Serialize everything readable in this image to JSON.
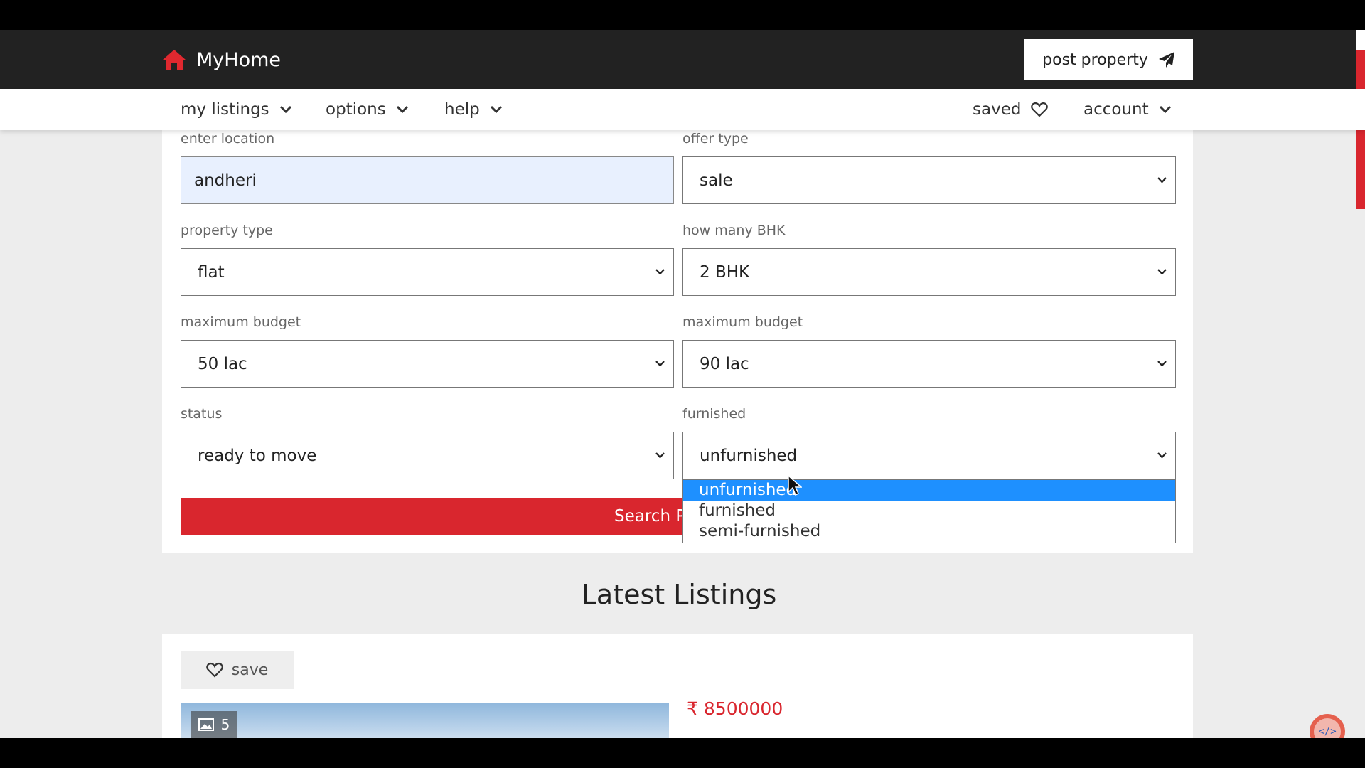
{
  "header": {
    "logo_text": "MyHome",
    "logo_icon": "home-icon",
    "post_property_label": "post property",
    "post_property_icon": "paper-plane-icon"
  },
  "nav": {
    "my_listings": "my listings",
    "options": "options",
    "help": "help",
    "saved": "saved",
    "account": "account"
  },
  "form": {
    "location": {
      "label": "enter location",
      "value": "andheri"
    },
    "offer_type": {
      "label": "offer type",
      "value": "sale"
    },
    "property_type": {
      "label": "property type",
      "value": "flat"
    },
    "bhk": {
      "label": "how many BHK",
      "value": "2 BHK"
    },
    "min_budget": {
      "label": "maximum budget",
      "value": "50 lac"
    },
    "max_budget": {
      "label": "maximum budget",
      "value": "90 lac"
    },
    "status": {
      "label": "status",
      "value": "ready to move"
    },
    "furnished": {
      "label": "furnished",
      "value": "unfurnished",
      "options": [
        "unfurnished",
        "furnished",
        "semi-furnished"
      ],
      "highlighted": "unfurnished"
    },
    "search_label_visible": "Search P"
  },
  "listings": {
    "title": "Latest Listings",
    "save_label": "save",
    "image_count": "5",
    "price": "8500000",
    "currency_symbol": "₹"
  },
  "colors": {
    "brand_red": "#d9262e",
    "header_dark": "#222222",
    "highlight_blue": "#1e90ff"
  }
}
